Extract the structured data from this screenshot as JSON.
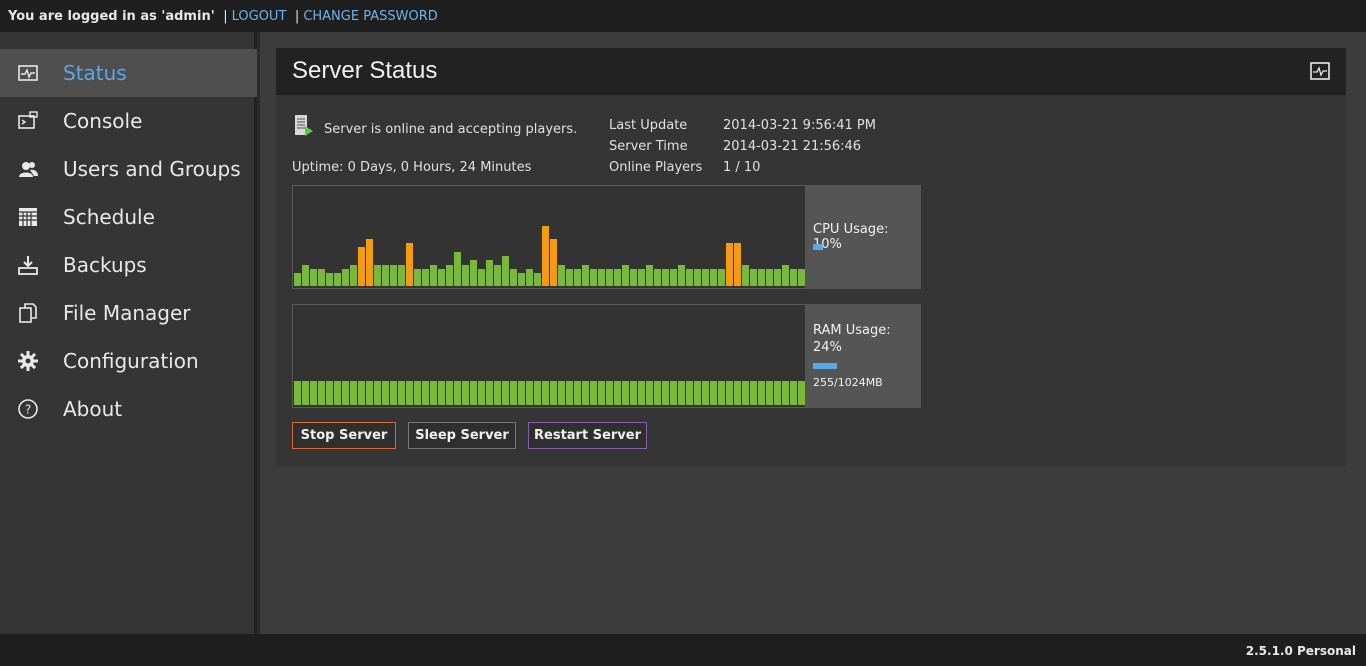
{
  "topbar": {
    "logged_in_text": "You are logged in as 'admin'",
    "separator": "|",
    "logout_label": "LOGOUT",
    "change_password_label": "CHANGE PASSWORD"
  },
  "sidebar": {
    "items": [
      {
        "label": "Status",
        "icon": "status-monitor-icon",
        "active": true
      },
      {
        "label": "Console",
        "icon": "console-icon",
        "active": false
      },
      {
        "label": "Users and Groups",
        "icon": "users-icon",
        "active": false
      },
      {
        "label": "Schedule",
        "icon": "calendar-icon",
        "active": false
      },
      {
        "label": "Backups",
        "icon": "download-icon",
        "active": false
      },
      {
        "label": "File Manager",
        "icon": "files-icon",
        "active": false
      },
      {
        "label": "Configuration",
        "icon": "gear-icon",
        "active": false
      },
      {
        "label": "About",
        "icon": "help-icon",
        "active": false
      }
    ]
  },
  "panel": {
    "title": "Server Status",
    "header_icon": "status-monitor-icon"
  },
  "status": {
    "message": "Server is online and accepting players.",
    "uptime": "Uptime: 0 Days, 0 Hours, 24 Minutes",
    "last_update_label": "Last Update",
    "last_update_value": "2014-03-21 9:56:41 PM",
    "server_time_label": "Server Time",
    "server_time_value": "2014-03-21 21:56:46",
    "online_players_label": "Online Players",
    "online_players_value": "1 / 10"
  },
  "cpu": {
    "label": "CPU Usage: 10%",
    "percent": 10,
    "bars": [
      3,
      5,
      4,
      4,
      3,
      3,
      4,
      5,
      9,
      11,
      5,
      5,
      5,
      5,
      10,
      4,
      4,
      5,
      4,
      5,
      8,
      5,
      6,
      4,
      6,
      5,
      7,
      4,
      3,
      4,
      3,
      14,
      11,
      5,
      4,
      4,
      5,
      4,
      4,
      4,
      4,
      5,
      4,
      4,
      5,
      4,
      4,
      4,
      5,
      4,
      4,
      4,
      4,
      4,
      10,
      10,
      5,
      4,
      4,
      4,
      4,
      5,
      4,
      4
    ],
    "max_bar": 14,
    "highlight_threshold": 9,
    "colors": {
      "normal": "#7ab839",
      "high": "#f39c12",
      "indicator": "#5aa8e6"
    }
  },
  "ram": {
    "label": "RAM Usage:",
    "percent_label": "24%",
    "detail": "255/1024MB",
    "percent": 24,
    "bar_count": 64
  },
  "buttons": {
    "stop": {
      "label": "Stop Server",
      "border": "#d9693a"
    },
    "sleep": {
      "label": "Sleep Server",
      "border": "#777777"
    },
    "restart": {
      "label": "Restart Server",
      "border": "#8a5cb0"
    }
  },
  "footer": {
    "version": "2.5.1.0 Personal"
  }
}
